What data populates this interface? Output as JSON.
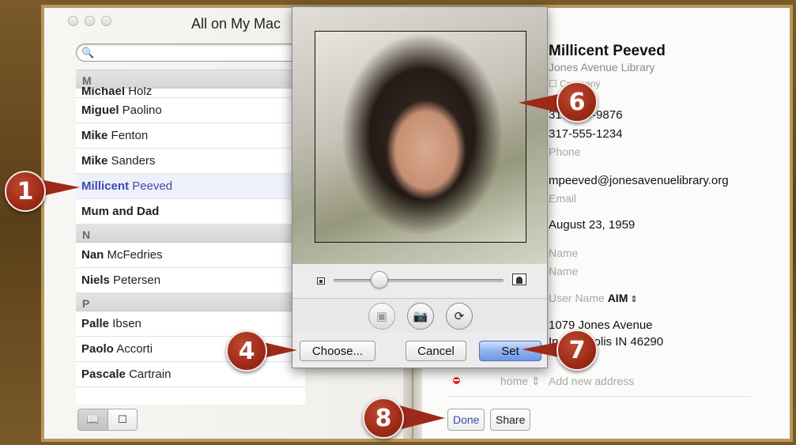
{
  "window": {
    "group_title": "All on My Mac"
  },
  "search": {
    "placeholder": ""
  },
  "contacts": {
    "sections": [
      {
        "letter": "M",
        "rows": [
          {
            "first": "Michael",
            "last": "Holz",
            "clipped": true
          },
          {
            "first": "Miguel",
            "last": "Paolino"
          },
          {
            "first": "Mike",
            "last": "Fenton"
          },
          {
            "first": "Mike",
            "last": "Sanders"
          },
          {
            "first": "Millicent",
            "last": "Peeved",
            "selected": true
          },
          {
            "first": "Mum and Dad",
            "last": ""
          }
        ]
      },
      {
        "letter": "N",
        "rows": [
          {
            "first": "Nan",
            "last": "McFedries"
          },
          {
            "first": "Niels",
            "last": "Petersen"
          }
        ]
      },
      {
        "letter": "P",
        "rows": [
          {
            "first": "Palle",
            "last": "Ibsen"
          },
          {
            "first": "Paolo",
            "last": "Accorti"
          },
          {
            "first": "Pascale",
            "last": "Cartrain"
          }
        ]
      }
    ]
  },
  "card": {
    "name": "Millicent Peeved",
    "company": "Jones Avenue Library",
    "company_check": "Company",
    "phone_1": "317-555-9876",
    "phone_2": "317-555-1234",
    "phone_label": "Phone",
    "email": "mpeeved@jonesavenuelibrary.org",
    "email_label": "Email",
    "birthday": "August 23, 1959",
    "name_label_1": "Name",
    "name_label_2": "Name",
    "im_label": "User Name",
    "im_service": "AIM",
    "address_line1": "1079 Jones Avenue",
    "address_line2": "Indianapolis IN 46290",
    "address_type": "home",
    "add_address": "Add new address"
  },
  "bottom": {
    "done_label": "Done",
    "share_label": "Share"
  },
  "popover": {
    "choose_label": "Choose...",
    "cancel_label": "Cancel",
    "set_label": "Set",
    "zoom_level": 0.27
  },
  "callouts": [
    "1",
    "4",
    "6",
    "7",
    "8"
  ]
}
